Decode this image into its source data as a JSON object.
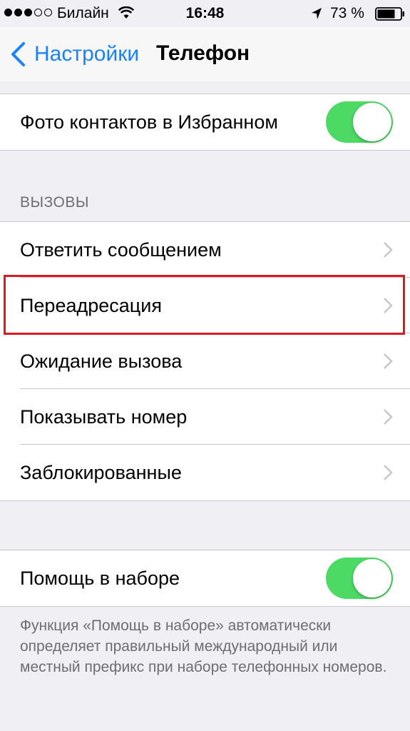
{
  "status_bar": {
    "carrier": "Билайн",
    "time": "16:48",
    "battery_percent": "73 %",
    "icons": [
      "signal-dots",
      "wifi-icon",
      "location-icon",
      "battery-icon"
    ]
  },
  "nav_bar": {
    "back_label": "Настройки",
    "title": "Телефон",
    "accent_color": "#1a82fb"
  },
  "group_favorites": {
    "label": "Фото контактов в Избранном",
    "toggle_on": true
  },
  "calls_section": {
    "header": "ВЫЗОВЫ",
    "items": [
      {
        "label": "Ответить сообщением"
      },
      {
        "label": "Переадресация"
      },
      {
        "label": "Ожидание вызова"
      },
      {
        "label": "Показывать номер"
      },
      {
        "label": "Заблокированные"
      }
    ]
  },
  "dial_assist": {
    "label": "Помощь в наборе",
    "toggle_on": true,
    "description": "Функция «Помощь в наборе» автоматически определяет правильный международный или местный префикс при наборе телефонных номеров."
  },
  "colors": {
    "toggle_on": "#4cd964",
    "highlight": "#d81b24",
    "background": "#efeff4"
  }
}
